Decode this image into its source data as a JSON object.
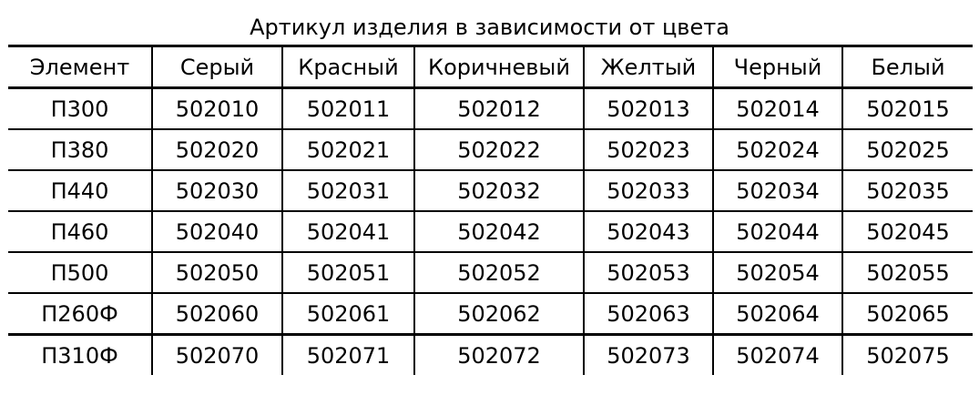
{
  "title": "Артикул изделия в зависимости от цвета",
  "headers": [
    "Элемент",
    "Серый",
    "Красный",
    "Коричневый",
    "Желтый",
    "Черный",
    "Белый"
  ],
  "rows": [
    [
      "П300",
      "502010",
      "502011",
      "502012",
      "502013",
      "502014",
      "502015"
    ],
    [
      "П380",
      "502020",
      "502021",
      "502022",
      "502023",
      "502024",
      "502025"
    ],
    [
      "П440",
      "502030",
      "502031",
      "502032",
      "502033",
      "502034",
      "502035"
    ],
    [
      "П460",
      "502040",
      "502041",
      "502042",
      "502043",
      "502044",
      "502045"
    ],
    [
      "П500",
      "502050",
      "502051",
      "502052",
      "502053",
      "502054",
      "502055"
    ],
    [
      "П260Ф",
      "502060",
      "502061",
      "502062",
      "502063",
      "502064",
      "502065"
    ],
    [
      "П310Ф",
      "502070",
      "502071",
      "502072",
      "502073",
      "502074",
      "502075"
    ]
  ]
}
